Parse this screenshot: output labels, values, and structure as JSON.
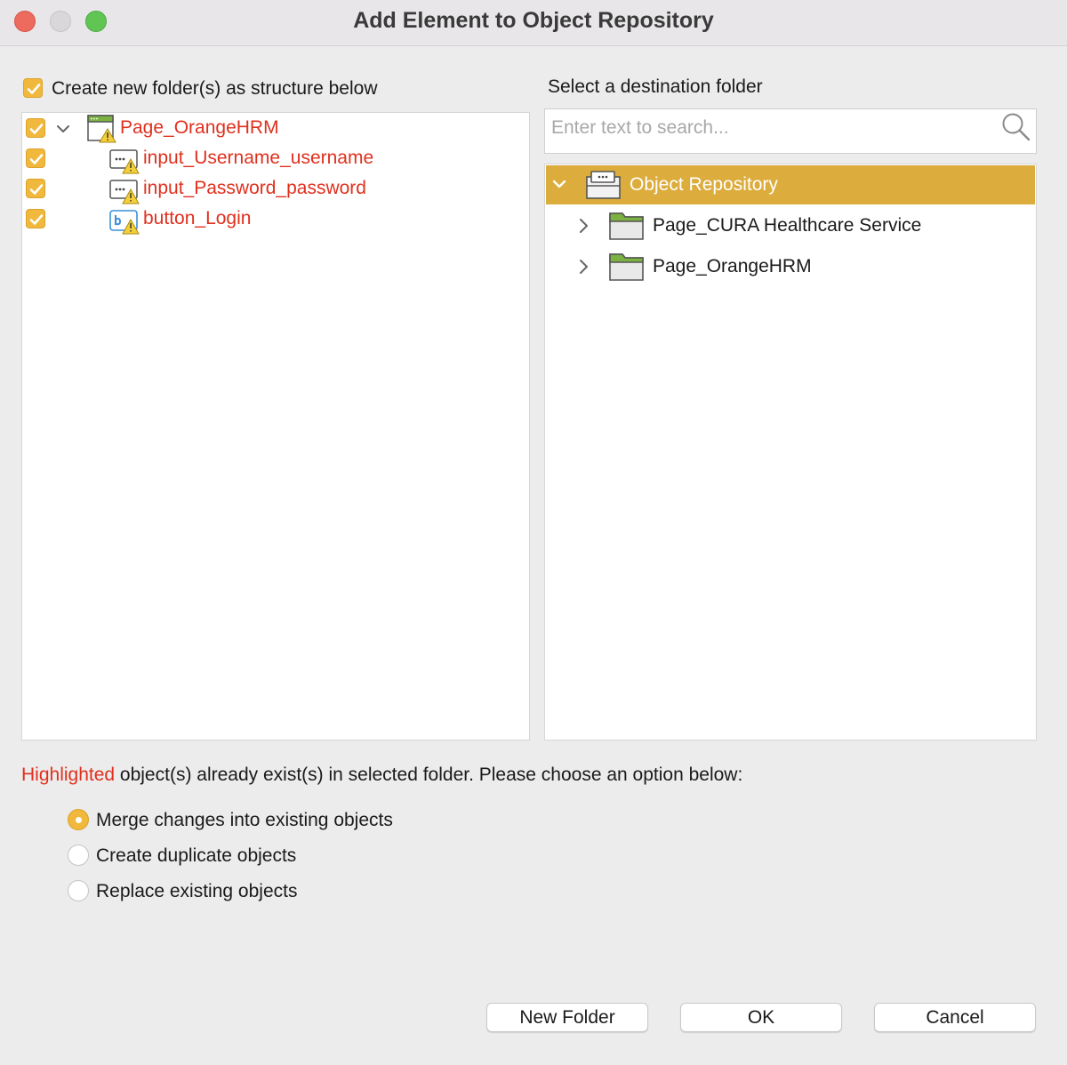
{
  "window": {
    "title": "Add Element to Object Repository"
  },
  "left": {
    "create_folder_checkbox": {
      "label": "Create new folder(s) as structure below",
      "checked": true
    },
    "tree": [
      {
        "label": "Page_OrangeHRM",
        "checked": true,
        "expanded": true,
        "icon": "page-warning-icon"
      },
      {
        "label": "input_Username_username",
        "checked": true,
        "icon": "input-warning-icon"
      },
      {
        "label": "input_Password_password",
        "checked": true,
        "icon": "input-warning-icon"
      },
      {
        "label": "button_Login",
        "checked": true,
        "icon": "button-warning-icon"
      }
    ]
  },
  "right": {
    "heading": "Select a destination folder",
    "search": {
      "placeholder": "Enter text to search...",
      "value": ""
    },
    "tree": {
      "root": {
        "label": "Object Repository",
        "selected": true,
        "expanded": true
      },
      "children": [
        {
          "label": "Page_CURA Healthcare Service",
          "expanded": false
        },
        {
          "label": "Page_OrangeHRM",
          "expanded": false
        }
      ]
    }
  },
  "notice": {
    "highlight": "Highlighted",
    "text": " object(s) already exist(s) in selected folder. Please choose an option below:"
  },
  "options": [
    {
      "label": "Merge changes into existing objects",
      "selected": true
    },
    {
      "label": "Create duplicate objects",
      "selected": false
    },
    {
      "label": "Replace existing objects",
      "selected": false
    }
  ],
  "buttons": {
    "new_folder": "New Folder",
    "ok": "OK",
    "cancel": "Cancel"
  },
  "colors": {
    "accent": "#f0b83c",
    "selected_row": "#dcac3c",
    "highlight_text": "#e0301e"
  }
}
